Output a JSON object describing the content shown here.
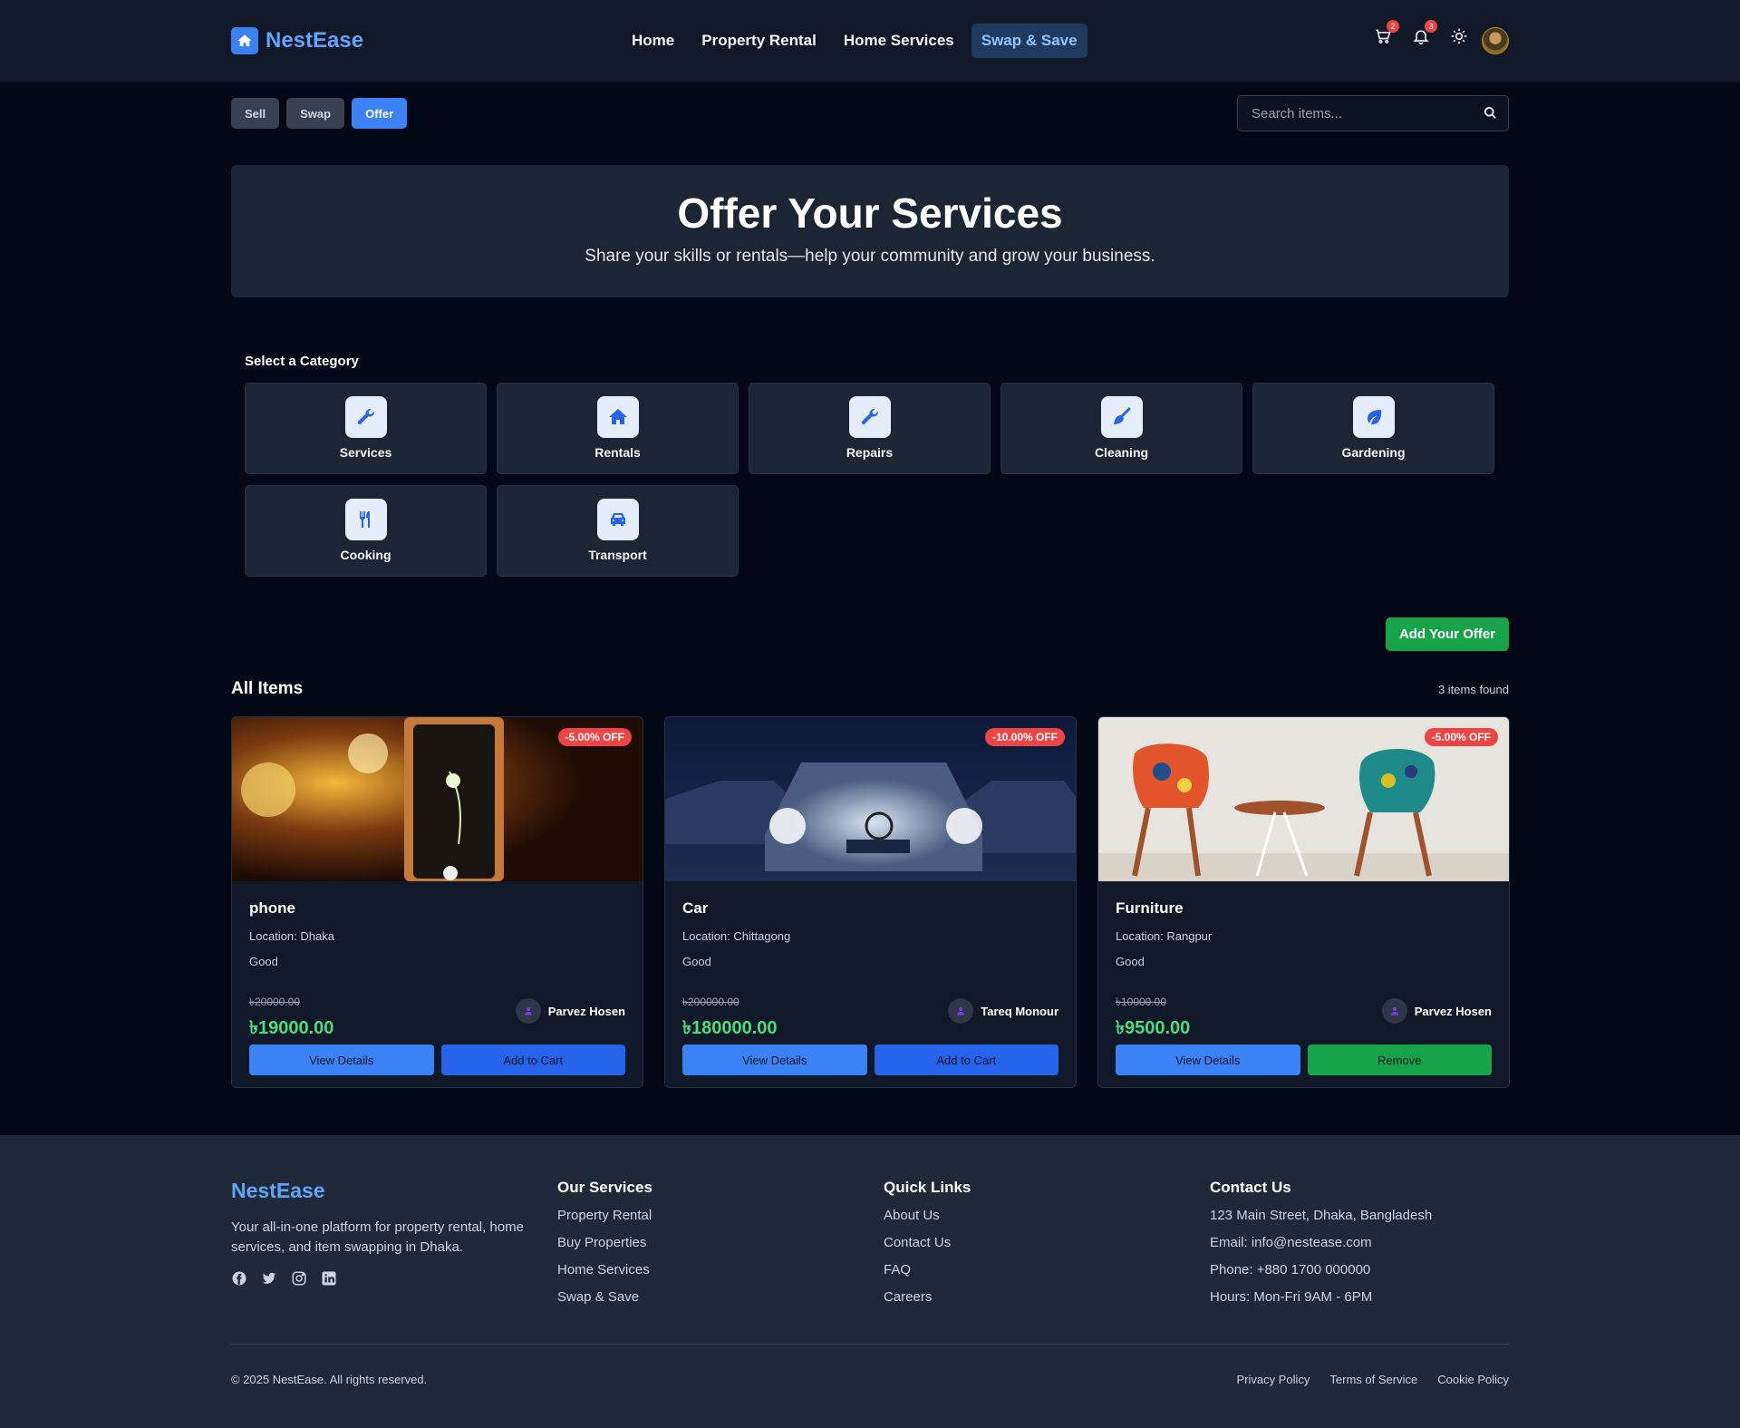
{
  "header": {
    "brand": "NestEase",
    "nav": [
      "Home",
      "Property Rental",
      "Home Services",
      "Swap & Save"
    ],
    "active_nav": "Swap & Save",
    "cart_count": "2",
    "notification_count": "3"
  },
  "subtabs": [
    "Sell",
    "Swap",
    "Offer"
  ],
  "active_subtab": "Offer",
  "search": {
    "placeholder": "Search items..."
  },
  "hero": {
    "title": "Offer Your Services",
    "subtitle": "Share your skills or rentals—help your community and grow your business."
  },
  "categories": {
    "title": "Select a Category",
    "items": [
      {
        "label": "Services",
        "icon": "wrench-icon"
      },
      {
        "label": "Rentals",
        "icon": "home-icon"
      },
      {
        "label": "Repairs",
        "icon": "wrench-icon"
      },
      {
        "label": "Cleaning",
        "icon": "broom-icon"
      },
      {
        "label": "Gardening",
        "icon": "leaf-icon"
      },
      {
        "label": "Cooking",
        "icon": "utensils-icon"
      },
      {
        "label": "Transport",
        "icon": "car-icon"
      }
    ]
  },
  "add_offer_label": "Add Your Offer",
  "items": {
    "title": "All Items",
    "count_text": "3 items found",
    "list": [
      {
        "name": "phone",
        "discount": "-5.00% OFF",
        "location": "Location: Dhaka",
        "condition": "Good",
        "old_price": "৳20000.00",
        "price": "৳19000.00",
        "seller": "Parvez Hosen",
        "btn1": "View Details",
        "btn2": "Add to Cart"
      },
      {
        "name": "Car",
        "discount": "-10.00% OFF",
        "location": "Location: Chittagong",
        "condition": "Good",
        "old_price": "৳200000.00",
        "price": "৳180000.00",
        "seller": "Tareq Monour",
        "btn1": "View Details",
        "btn2": "Add to Cart"
      },
      {
        "name": "Furniture",
        "discount": "-5.00% OFF",
        "location": "Location: Rangpur",
        "condition": "Good",
        "old_price": "৳10000.00",
        "price": "৳9500.00",
        "seller": "Parvez Hosen",
        "btn1": "View Details",
        "btn2": "Remove"
      }
    ]
  },
  "footer": {
    "brand": "NestEase",
    "description": "Your all-in-one platform for property rental, home services, and item swapping in Dhaka.",
    "services_title": "Our Services",
    "services": [
      "Property Rental",
      "Buy Properties",
      "Home Services",
      "Swap & Save"
    ],
    "links_title": "Quick Links",
    "links": [
      "About Us",
      "Contact Us",
      "FAQ",
      "Careers"
    ],
    "contact_title": "Contact Us",
    "contact": [
      "123 Main Street, Dhaka, Bangladesh",
      "Email: info@nestease.com",
      "Phone: +880 1700 000000",
      "Hours: Mon-Fri 9AM - 6PM"
    ],
    "copyright": "© 2025 NestEase. All rights reserved.",
    "legal": [
      "Privacy Policy",
      "Terms of Service",
      "Cookie Policy"
    ]
  },
  "colors": {
    "background": "#030816",
    "accent": "#3b82f6",
    "success": "#16a34a",
    "discount": "#ef4444",
    "price": "#4ade80"
  }
}
